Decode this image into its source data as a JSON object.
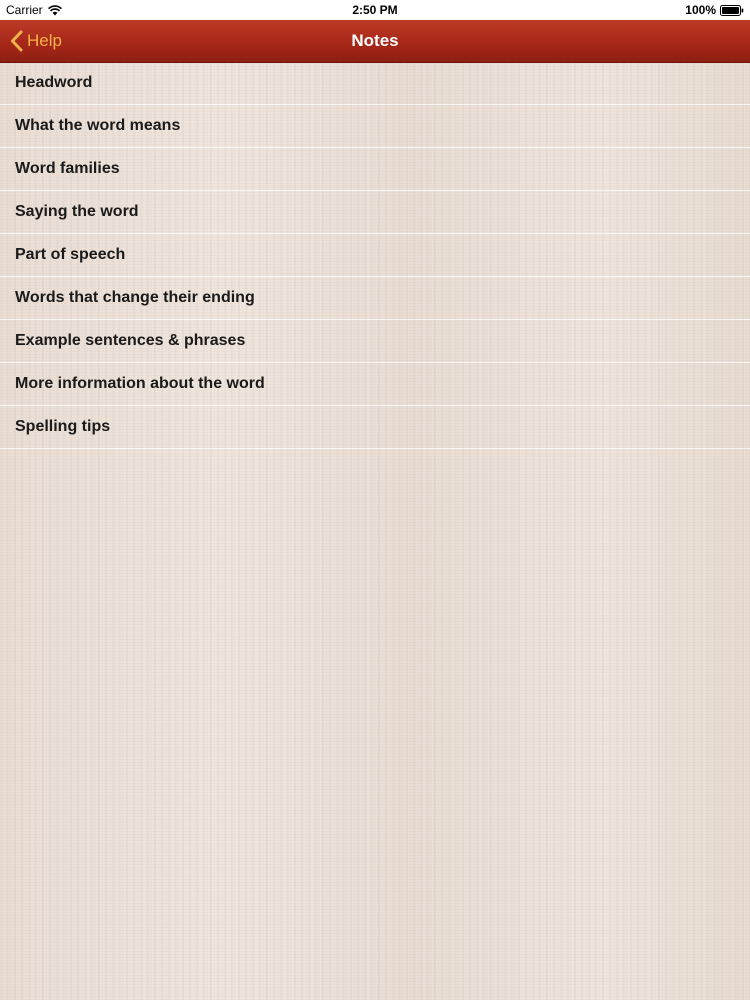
{
  "status_bar": {
    "carrier": "Carrier",
    "time": "2:50 PM",
    "battery": "100%",
    "icons": [
      "wifi-icon",
      "battery-icon"
    ]
  },
  "nav_bar": {
    "back_label": "Help",
    "back_icon": "chevron-left-icon",
    "title": "Notes",
    "background_color": "#a72819",
    "back_color": "#f2b24a"
  },
  "list": {
    "items": [
      {
        "label": "Headword"
      },
      {
        "label": "What the word means"
      },
      {
        "label": "Word families"
      },
      {
        "label": "Saying the word"
      },
      {
        "label": "Part of speech"
      },
      {
        "label": "Words that change their ending"
      },
      {
        "label": "Example sentences & phrases"
      },
      {
        "label": "More information about the word"
      },
      {
        "label": "Spelling tips"
      }
    ]
  }
}
